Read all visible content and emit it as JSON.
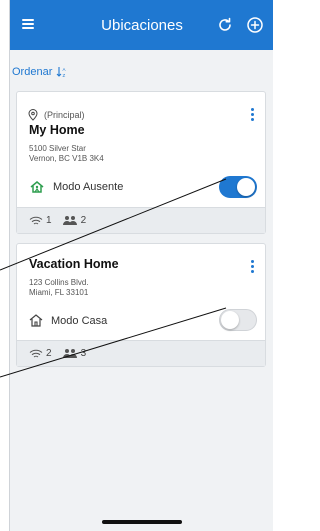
{
  "header": {
    "title": "Ubicaciones",
    "menu_icon": "menu-icon",
    "refresh_icon": "refresh-icon",
    "add_icon": "add-icon",
    "background": "#1f78d1"
  },
  "sort": {
    "label": "Ordenar"
  },
  "locations": [
    {
      "tag": "(Principal)",
      "name": "My Home",
      "address_line1": "5100 Silver Star",
      "address_line2": "Vernon, BC V1B 3K4",
      "mode": "Modo Ausente",
      "toggle_on": true,
      "wifi_count": "1",
      "users_count": "2"
    },
    {
      "name": "Vacation Home",
      "address_line1": "123 Collins Blvd.",
      "address_line2": "Miami, FL 33101",
      "mode": "Modo Casa",
      "toggle_on": false,
      "wifi_count": "2",
      "users_count": "3"
    }
  ],
  "colors": {
    "accent": "#1f78d1",
    "away_icon": "#2e9e4f"
  }
}
